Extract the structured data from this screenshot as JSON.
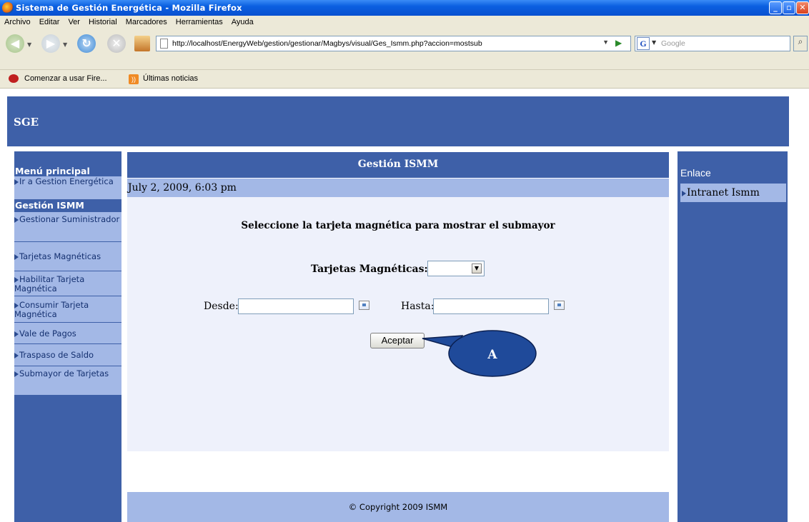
{
  "browser": {
    "window_title": "Sistema de Gestión Energética - Mozilla Firefox",
    "menu": [
      "Archivo",
      "Editar",
      "Ver",
      "Historial",
      "Marcadores",
      "Herramientas",
      "Ayuda"
    ],
    "url": "http://localhost/EnergyWeb/gestion/gestionar/Magbys/visual/Ges_Ismm.php?accion=mostsub",
    "search_placeholder": "Google",
    "bookmarks": [
      "Comenzar a usar Fire...",
      "Últimas noticias"
    ]
  },
  "header": {
    "brand": "SGE"
  },
  "left_menu": {
    "heading_main": "Menú principal",
    "item_go_gestion": "Ir a Gestion Energética",
    "heading_section": "Gestión ISMM",
    "items": [
      "Gestionar Suministrador",
      "Tarjetas Magnéticas",
      "Habilitar Tarjeta Magnética",
      "Consumir Tarjeta Magnética",
      "Vale de Pagos",
      "Traspaso de Saldo",
      "Submayor de Tarjetas"
    ]
  },
  "main": {
    "title": "Gestión ISMM",
    "date": "July 2, 2009, 6:03 pm",
    "prompt": "Seleccione la tarjeta magnética para mostrar el submayor",
    "tarjetas_label": "Tarjetas Magnéticas:",
    "tarjetas_value": "",
    "desde_label": "Desde:",
    "desde_value": "",
    "hasta_label": "Hasta:",
    "hasta_value": "",
    "submit_label": "Aceptar",
    "footer": "© Copyright 2009 ISMM"
  },
  "right_menu": {
    "heading": "Enlace",
    "item": "Intranet Ismm"
  },
  "annotation": {
    "label": "A"
  },
  "colors": {
    "nav_blue": "#3e60a8",
    "light_blue": "#a3b8e6",
    "form_bg": "#eef1fb",
    "callout_fill": "#1f4a9a"
  }
}
